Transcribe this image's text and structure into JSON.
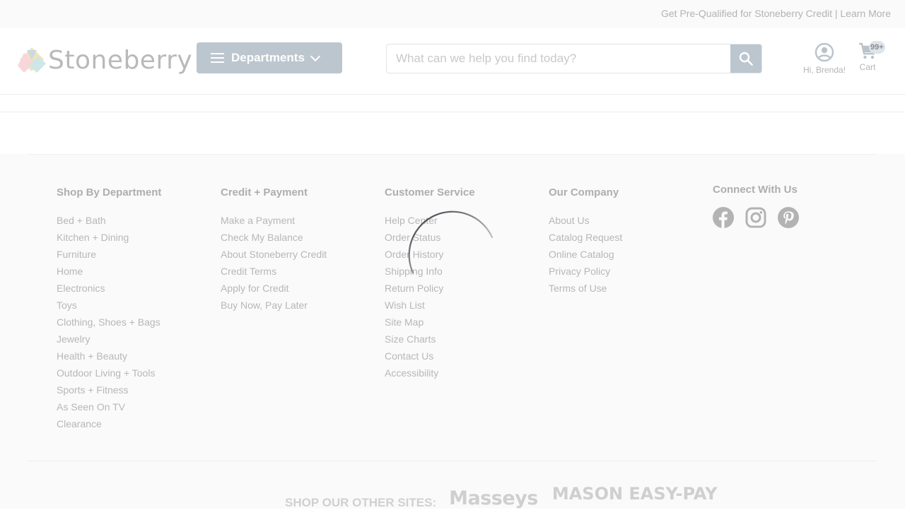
{
  "topbar": {
    "promo": "Get Pre-Qualified for Stoneberry Credit | Learn More"
  },
  "header": {
    "logo_text": "Stoneberry",
    "departments_label": "Departments",
    "search_placeholder": "What can we help you find today?",
    "account_label": "Hi, Brenda!",
    "cart_label": "Cart",
    "cart_count": "99+"
  },
  "footer": {
    "columns": [
      {
        "title": "Shop By Department",
        "items": [
          "Bed + Bath",
          "Kitchen + Dining",
          "Furniture",
          "Home",
          "Electronics",
          "Toys",
          "Clothing, Shoes + Bags",
          "Jewelry",
          "Health + Beauty",
          "Outdoor Living + Tools",
          "Sports + Fitness",
          "As Seen On TV",
          "Clearance"
        ]
      },
      {
        "title": "Credit + Payment",
        "items": [
          "Make a Payment",
          "Check My Balance",
          "About Stoneberry Credit",
          "Credit Terms",
          "Apply for Credit",
          "Buy Now, Pay Later"
        ]
      },
      {
        "title": "Customer Service",
        "items": [
          "Help Center",
          "Order Status",
          "Order History",
          "Shipping Info",
          "Return Policy",
          "Wish List",
          "Site Map",
          "Size Charts",
          "Contact Us",
          "Accessibility"
        ]
      },
      {
        "title": "Our Company",
        "items": [
          "About Us",
          "Catalog Request",
          "Online Catalog",
          "Privacy Policy",
          "Terms of Use"
        ]
      }
    ],
    "social": {
      "title": "Connect With Us",
      "icons": [
        "facebook-icon",
        "instagram-icon",
        "pinterest-icon"
      ]
    },
    "other_sites": {
      "label": "SHOP OUR OTHER SITES:",
      "sites": [
        "Masseys",
        "MASON EASY-PAY"
      ]
    }
  },
  "colors": {
    "accent": "#bcc6cf",
    "footer_bg": "#fafafa",
    "spinner": "#2e2e3a"
  }
}
